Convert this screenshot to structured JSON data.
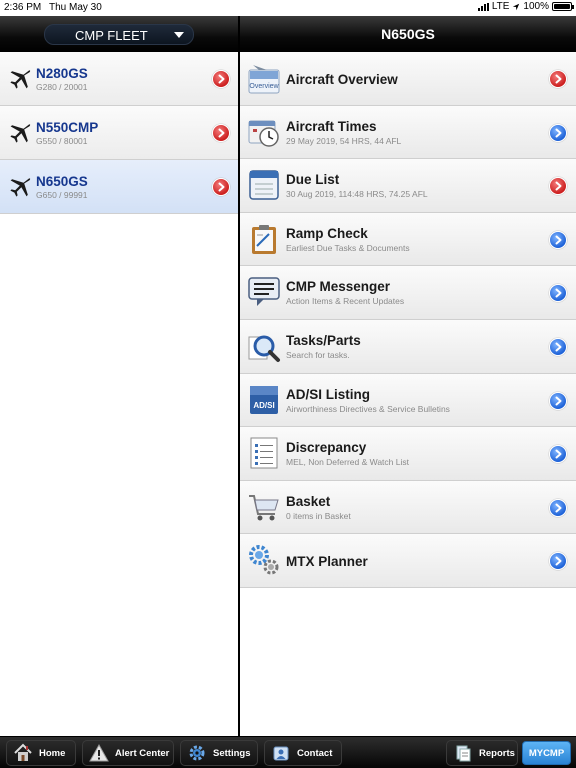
{
  "status_bar": {
    "time": "2:36 PM",
    "date": "Thu May 30",
    "carrier": "LTE",
    "battery": "100%",
    "battery_level": 1.0
  },
  "fleet": {
    "selector_label": "CMP FLEET",
    "aircraft": [
      {
        "name": "N280GS",
        "detail": "G280 / 20001",
        "selected": false
      },
      {
        "name": "N550CMP",
        "detail": "G550 / 80001",
        "selected": false
      },
      {
        "name": "N650GS",
        "detail": "G650 / 99991",
        "selected": true
      }
    ]
  },
  "detail": {
    "title": "N650GS",
    "items": [
      {
        "title": "Aircraft Overview",
        "subtitle": "",
        "icon": "aircraft-overview-icon",
        "icon_text": "Overview",
        "status": "red"
      },
      {
        "title": "Aircraft Times",
        "subtitle": "29 May 2019, 54 HRS, 44 AFL",
        "icon": "aircraft-times-icon",
        "status": "blue"
      },
      {
        "title": "Due List",
        "subtitle": "30 Aug 2019, 114:48 HRS, 74.25 AFL",
        "icon": "due-list-icon",
        "status": "red"
      },
      {
        "title": "Ramp Check",
        "subtitle": "Earliest Due Tasks & Documents",
        "icon": "clipboard-icon",
        "status": "blue"
      },
      {
        "title": "CMP Messenger",
        "subtitle": "Action Items & Recent Updates",
        "icon": "message-icon",
        "status": "blue"
      },
      {
        "title": "Tasks/Parts",
        "subtitle": "Search for tasks.",
        "icon": "magnifier-icon",
        "status": "blue"
      },
      {
        "title": "AD/SI Listing",
        "subtitle": "Airworthiness Directives & Service Bulletins",
        "icon": "adsi-binder-icon",
        "icon_text": "AD/SI",
        "status": "blue"
      },
      {
        "title": "Discrepancy",
        "subtitle": "MEL, Non Deferred & Watch List",
        "icon": "list-icon",
        "status": "blue"
      },
      {
        "title": "Basket",
        "subtitle": "0 items in Basket",
        "icon": "cart-icon",
        "status": "blue"
      },
      {
        "title": "MTX Planner",
        "subtitle": "",
        "icon": "gears-icon",
        "status": "blue"
      }
    ]
  },
  "toolbar": {
    "home": "Home",
    "alert_center": "Alert Center",
    "settings": "Settings",
    "contact": "Contact",
    "reports": "Reports",
    "mycmp": "MYCMP"
  },
  "colors": {
    "accent_blue": "#1f63d8",
    "alert_red": "#cc1f1f",
    "aircraft_name": "#16378e",
    "mycmp_button": "#2a83d4"
  }
}
